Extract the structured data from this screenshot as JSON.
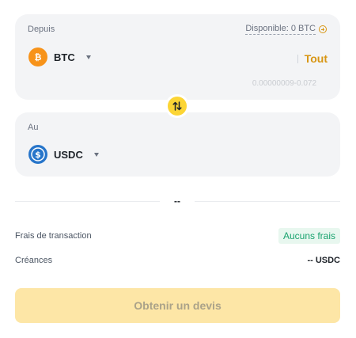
{
  "from": {
    "label": "Depuis",
    "available": "Disponible: 0 BTC",
    "asset": "BTC",
    "amount_placeholder": "",
    "max_label": "Tout",
    "range": "0.00000009-0.072",
    "coin_icon": "bitcoin-icon",
    "coin_color": "#f7931a"
  },
  "to": {
    "label": "Au",
    "asset": "USDC",
    "coin_icon": "usdc-icon",
    "coin_color": "#2775ca"
  },
  "rate": "--",
  "fees": {
    "label": "Frais de transaction",
    "value": "Aucuns frais"
  },
  "receive": {
    "label": "Créances",
    "value": "-- USDC"
  },
  "quote_button": "Obtenir un devis",
  "colors": {
    "accent": "#fcd535",
    "accent_text": "#d89614",
    "fee_green": "#1aa36f"
  }
}
